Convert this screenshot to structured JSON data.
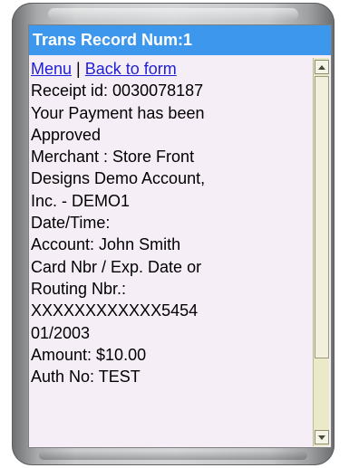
{
  "window": {
    "title": "Trans Record Num:1"
  },
  "nav": {
    "menu_label": "Menu",
    "separator": "|",
    "back_label": "Back to form"
  },
  "record": {
    "lines": [
      " Receipt id: 0030078187",
      " Your Payment has been",
      "Approved",
      "Merchant : Store Front",
      "Designs Demo Account,",
      "Inc. - DEMO1",
      " Date/Time:",
      " Account: John Smith",
      " Card Nbr / Exp. Date or",
      "Routing Nbr.:",
      "XXXXXXXXXXXX5454",
      "01/2003",
      " Amount: $10.00",
      " Auth No: TEST"
    ]
  },
  "scrollbar": {
    "up_icon": "arrow-up-icon",
    "down_icon": "arrow-down-icon"
  },
  "colors": {
    "title_bar": "#3d97ec",
    "screen_bg": "#f6eef6",
    "link": "#1f1fd6",
    "scrollbar_track": "#eaeac8"
  }
}
